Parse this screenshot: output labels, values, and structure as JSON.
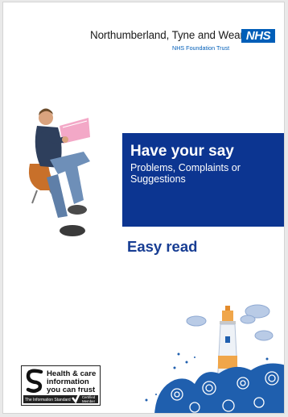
{
  "header": {
    "organisation": "Northumberland, Tyne and Wear",
    "nhs_logo": "NHS",
    "subtitle": "NHS Foundation Trust"
  },
  "title_box": {
    "heading": "Have your say",
    "subheading": "Problems, Complaints or Suggestions"
  },
  "easy_read": "Easy read",
  "badge": {
    "line1": "Health & care",
    "line2": "information",
    "line3": "you can trust",
    "footer_left": "The Information Standard",
    "footer_right": "Certified Member"
  },
  "colors": {
    "nhs_blue": "#005eb8",
    "title_box": "#0c3591",
    "easy_read_text": "#173d93",
    "wave_blue": "#1f5fae",
    "lighthouse_orange": "#f0a64a"
  }
}
